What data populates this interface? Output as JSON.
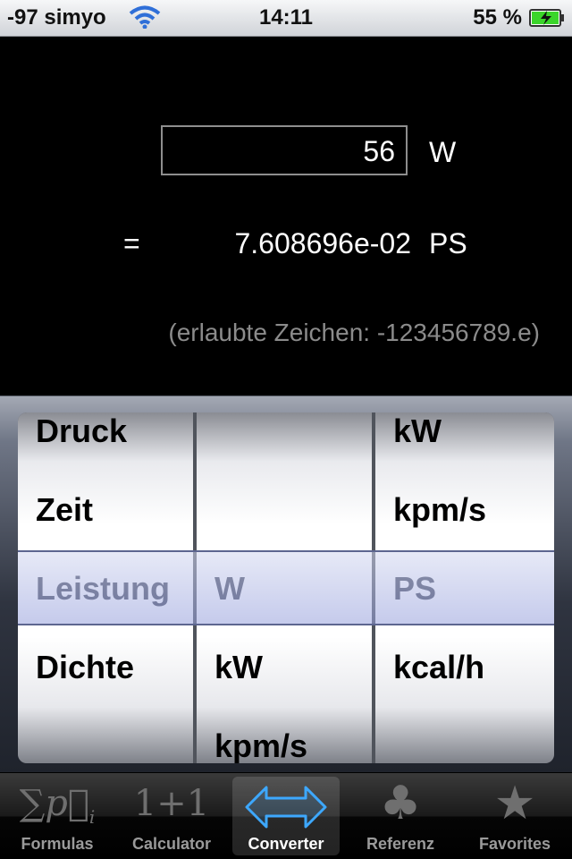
{
  "status_bar": {
    "carrier": "-97 simyo",
    "time": "14:11",
    "battery_percent": "55 %"
  },
  "converter": {
    "input_value": "56",
    "input_unit": "W",
    "equals": "=",
    "result_value": "7.608696e-02",
    "result_unit": "PS",
    "hint": "(erlaubte Zeichen: -123456789.e)"
  },
  "picker": {
    "column1": {
      "above": [
        "Druck",
        "Zeit"
      ],
      "selected": "Leistung",
      "below": [
        "Dichte"
      ]
    },
    "column2": {
      "above": [],
      "selected": "W",
      "below": [
        "kW",
        "kpm/s"
      ]
    },
    "column3": {
      "above": [
        "kW",
        "kpm/s"
      ],
      "selected": "PS",
      "below": [
        "kcal/h"
      ]
    }
  },
  "tabs": [
    {
      "label": "Formulas",
      "icon": "sum-formula-icon",
      "active": false
    },
    {
      "label": "Calculator",
      "icon": "one-plus-one-icon",
      "active": false
    },
    {
      "label": "Converter",
      "icon": "double-arrow-icon",
      "active": true
    },
    {
      "label": "Referenz",
      "icon": "club-icon",
      "active": false
    },
    {
      "label": "Favorites",
      "icon": "star-icon",
      "active": false
    }
  ],
  "colors": {
    "selection_tint": "#aab2e6",
    "tab_active_icon": "#3da8ff"
  }
}
